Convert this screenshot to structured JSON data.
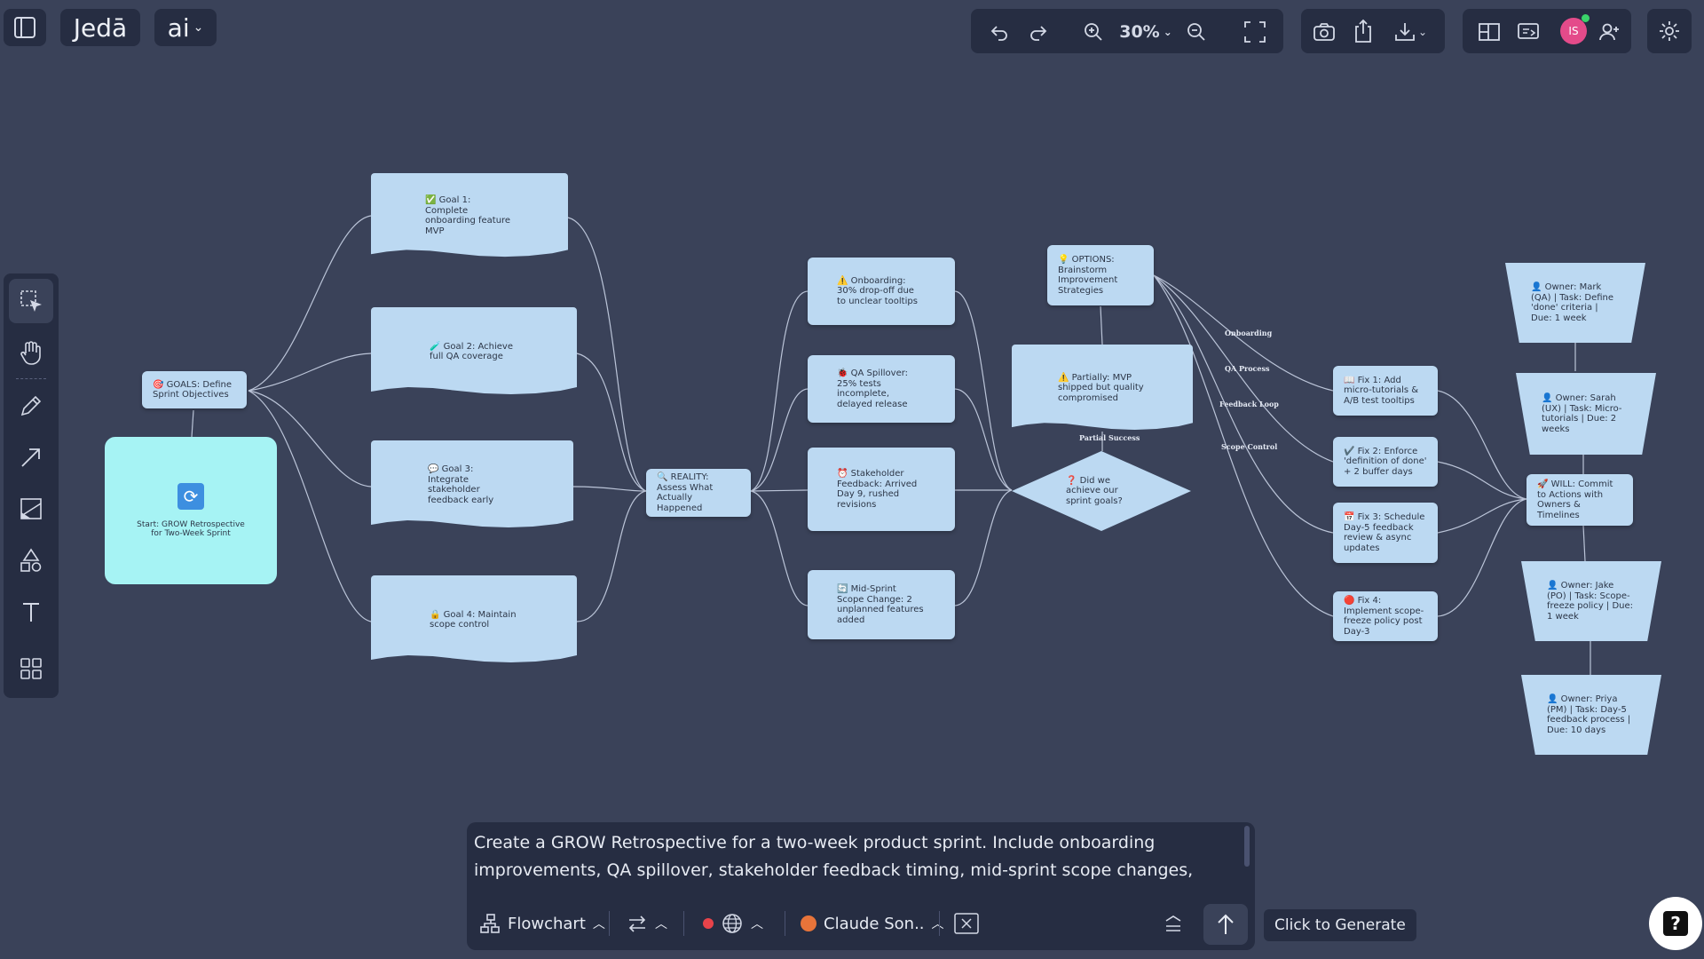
{
  "app": {
    "brand": "Jedā",
    "ai_label": "ai"
  },
  "toolbar": {
    "zoom": "30%"
  },
  "user": {
    "initials": "IS"
  },
  "canvas": {
    "start": "Start: GROW Retrospective for Two-Week Sprint",
    "goals": "🎯 GOALS: Define Sprint Objectives",
    "goal1": "✅ Goal 1: Complete onboarding feature MVP",
    "goal2": "🧪 Goal 2: Achieve full QA coverage",
    "goal3": "💬 Goal 3: Integrate stakeholder feedback early",
    "goal4": "🔒 Goal 4: Maintain scope control",
    "reality": "🔍 REALITY: Assess What Actually Happened",
    "r1": "⚠️ Onboarding: 30% drop-off due to unclear tooltips",
    "r2": "🐞 QA Spillover: 25% tests incomplete, delayed release",
    "r3": "⏰ Stakeholder Feedback: Arrived Day 9, rushed revisions",
    "r4": "🔄 Mid-Sprint Scope Change: 2 unplanned features added",
    "decision": "❓ Did we achieve our sprint goals?",
    "partial_label": "Partial Success",
    "partial": "⚠️ Partially: MVP shipped but quality compromised",
    "options": "💡 OPTIONS: Brainstorm Improvement Strategies",
    "e_onb": "Onboarding",
    "e_qa": "QA Process",
    "e_fb": "Feedback Loop",
    "e_sc": "Scope Control",
    "fix1": "📖 Fix 1: Add micro-tutorials & A/B test tooltips",
    "fix2": "✔️ Fix 2: Enforce 'definition of done' + 2 buffer days",
    "fix3": "📅 Fix 3: Schedule Day-5 feedback review & async updates",
    "fix4": "🔴 Fix 4: Implement scope-freeze policy post Day-3",
    "will": "🚀 WILL: Commit to Actions with Owners & Timelines",
    "o1": "👤 Owner: Mark (QA) | Task: Define 'done' criteria | Due: 1 week",
    "o2": "👤 Owner: Sarah (UX) | Task: Micro-tutorials | Due: 2 weeks",
    "o3": "👤 Owner: Jake (PO) | Task: Scope-freeze policy | Due: 1 week",
    "o4": "👤 Owner: Priya (PM) | Task: Day-5 feedback process | Due: 10 days"
  },
  "prompt": {
    "text": "Create a GROW Retrospective for a two-week product sprint. Include onboarding improvements, QA spillover, stakeholder feedback timing, mid-sprint scope changes, possible fixes, and named owners with timelines."
  },
  "bottombar": {
    "mode": "Flowchart",
    "model": "Claude Son..",
    "generate_tip": "Click to Generate"
  },
  "colors": {
    "background": "#3a4259",
    "panel": "#262d42",
    "node": "#bcd9f2",
    "start": "#a6f3f4"
  }
}
